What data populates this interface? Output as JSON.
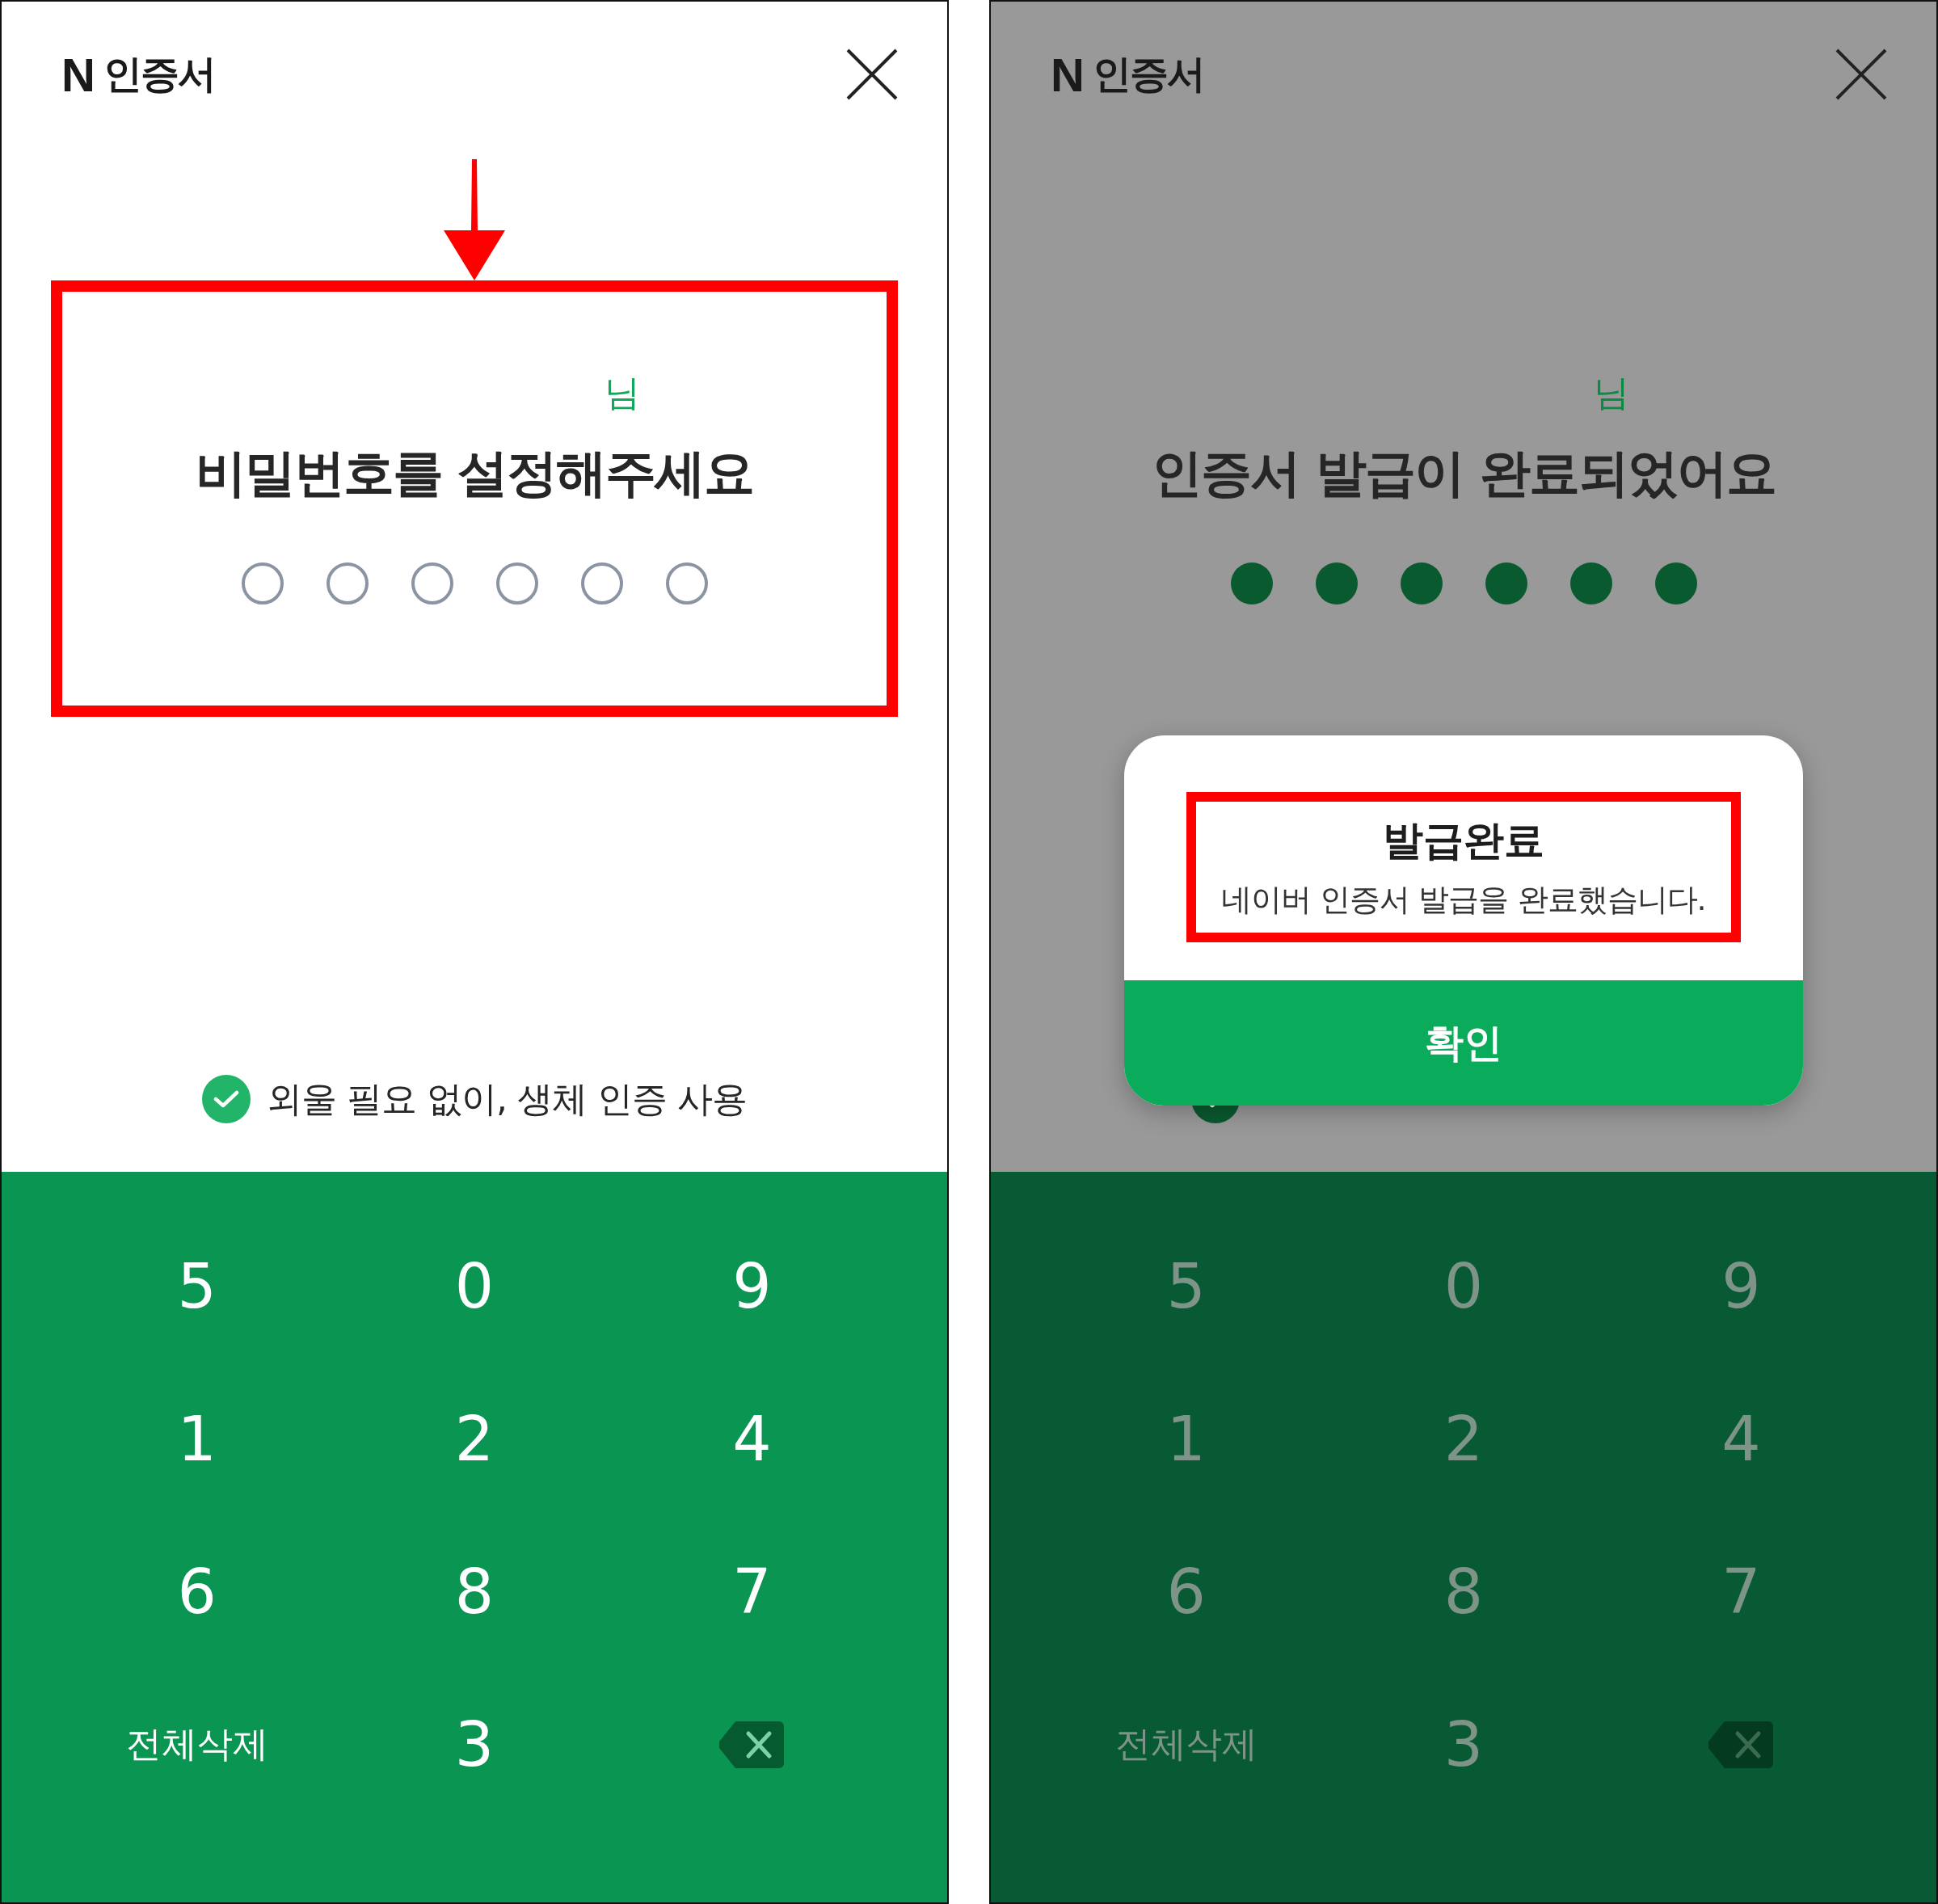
{
  "screens": [
    {
      "dimmed": false,
      "brand": {
        "mark": "N",
        "name": "인증서"
      },
      "annotation": {
        "arrow": true,
        "frame": true
      },
      "greeting_suffix": "님",
      "title": "비밀번호를 설정해주세요",
      "pin_dots": [
        {
          "filled": false
        },
        {
          "filled": false
        },
        {
          "filled": false
        },
        {
          "filled": false
        },
        {
          "filled": false
        },
        {
          "filled": false
        }
      ],
      "biometric": {
        "checked": true,
        "label": "외울 필요 없이, 생체 인증 사용"
      },
      "keys": [
        {
          "kind": "digit",
          "label": "5"
        },
        {
          "kind": "digit",
          "label": "0"
        },
        {
          "kind": "digit",
          "label": "9"
        },
        {
          "kind": "digit",
          "label": "1"
        },
        {
          "kind": "digit",
          "label": "2"
        },
        {
          "kind": "digit",
          "label": "4"
        },
        {
          "kind": "digit",
          "label": "6"
        },
        {
          "kind": "digit",
          "label": "8"
        },
        {
          "kind": "digit",
          "label": "7"
        },
        {
          "kind": "text",
          "label": "전체삭제"
        },
        {
          "kind": "digit",
          "label": "3"
        },
        {
          "kind": "backspace"
        }
      ]
    },
    {
      "dimmed": true,
      "brand": {
        "mark": "N",
        "name": "인증서"
      },
      "greeting_suffix": "님",
      "title": "인증서 발급이 완료되었어요",
      "pin_dots": [
        {
          "filled": true
        },
        {
          "filled": true
        },
        {
          "filled": true
        },
        {
          "filled": true
        },
        {
          "filled": true
        },
        {
          "filled": true
        }
      ],
      "biometric": {
        "checked": true
      },
      "keys": [
        {
          "kind": "digit",
          "label": "5"
        },
        {
          "kind": "digit",
          "label": "0"
        },
        {
          "kind": "digit",
          "label": "9"
        },
        {
          "kind": "digit",
          "label": "1"
        },
        {
          "kind": "digit",
          "label": "2"
        },
        {
          "kind": "digit",
          "label": "4"
        },
        {
          "kind": "digit",
          "label": "6"
        },
        {
          "kind": "digit",
          "label": "8"
        },
        {
          "kind": "digit",
          "label": "7"
        },
        {
          "kind": "text",
          "label": "전체삭제"
        },
        {
          "kind": "digit",
          "label": "3"
        },
        {
          "kind": "backspace"
        }
      ],
      "dialog": {
        "framed": true,
        "title": "발급완료",
        "message": "네이버 인증서 발급을 완료했습니다.",
        "button": "확인"
      }
    }
  ]
}
